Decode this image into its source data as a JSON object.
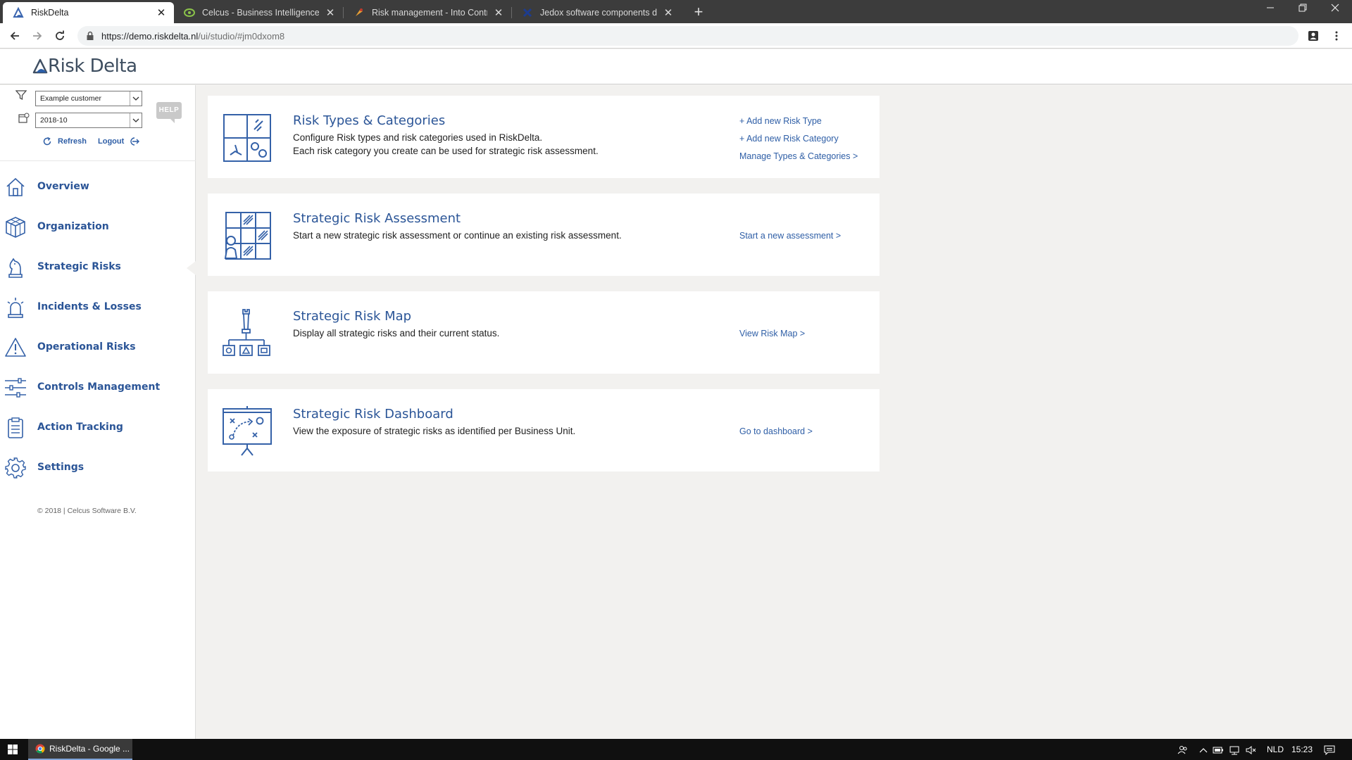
{
  "browser": {
    "tabs": [
      {
        "title": "RiskDelta",
        "favicon": "riskdelta-logo-icon",
        "active": true
      },
      {
        "title": "Celcus - Business Intelligence en",
        "favicon": "celcus-logo-icon",
        "active": false
      },
      {
        "title": "Risk management - Into Control",
        "favicon": "into-control-icon",
        "active": false
      },
      {
        "title": "Jedox software components drive",
        "favicon": "jedox-icon",
        "active": false
      }
    ],
    "new_tab": "+",
    "url_host": "https://demo.riskdelta.nl",
    "url_path": "/ui/studio/#jm0dxom8"
  },
  "app": {
    "logo_text": "Risk Delta",
    "accent_color": "#2b5597"
  },
  "filters": {
    "customer": "Example customer",
    "period": "2018-10",
    "help_label": "HELP",
    "refresh_label": "Refresh",
    "logout_label": "Logout"
  },
  "sidebar": {
    "items": [
      {
        "label": "Overview",
        "icon": "home-icon"
      },
      {
        "label": "Organization",
        "icon": "cube-icon"
      },
      {
        "label": "Strategic Risks",
        "icon": "chess-knight-icon"
      },
      {
        "label": "Incidents & Losses",
        "icon": "alarm-light-icon"
      },
      {
        "label": "Operational Risks",
        "icon": "warning-icon"
      },
      {
        "label": "Controls Management",
        "icon": "sliders-icon"
      },
      {
        "label": "Action Tracking",
        "icon": "clipboard-icon"
      },
      {
        "label": "Settings",
        "icon": "gear-icon"
      }
    ],
    "active_item": "Strategic Risks",
    "copyright": "© 2018 | Celcus Software B.V."
  },
  "cards": [
    {
      "title": "Risk Types & Categories",
      "description_lines": [
        "Configure Risk types and risk categories used in RiskDelta.",
        "Each risk category you create can be used for strategic risk assessment."
      ],
      "links": [
        "+ Add new Risk Type",
        "+ Add new Risk Category",
        "Manage Types & Categories >"
      ]
    },
    {
      "title": "Strategic Risk Assessment",
      "description_lines": [
        "Start a new strategic risk assessment or continue an existing risk assessment."
      ],
      "links": [
        "Start a new assessment >"
      ]
    },
    {
      "title": "Strategic Risk Map",
      "description_lines": [
        "Display all strategic risks and their current status."
      ],
      "links": [
        "View Risk Map >"
      ]
    },
    {
      "title": "Strategic Risk Dashboard",
      "description_lines": [
        "View the exposure of strategic risks as identified per Business Unit."
      ],
      "links": [
        "Go to dashboard >"
      ]
    }
  ],
  "taskbar": {
    "app_label": "RiskDelta - Google ...",
    "language": "NLD",
    "time": "15:23"
  }
}
